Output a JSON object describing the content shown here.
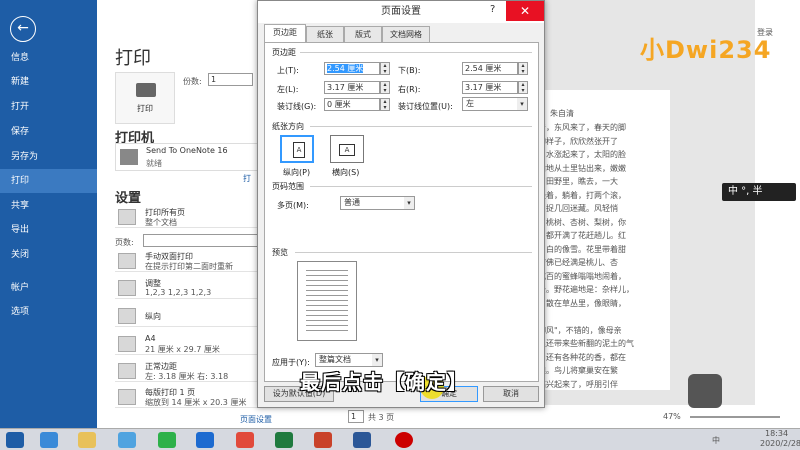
{
  "sidebar": {
    "back_label": "←",
    "items": [
      {
        "label": "信息"
      },
      {
        "label": "新建"
      },
      {
        "label": "打开"
      },
      {
        "label": "保存"
      },
      {
        "label": "另存为"
      },
      {
        "label": "打印"
      },
      {
        "label": "共享"
      },
      {
        "label": "导出"
      },
      {
        "label": "关闭"
      },
      {
        "label": "帐户"
      },
      {
        "label": "选项"
      }
    ]
  },
  "print": {
    "title": "打印",
    "print_button": "打印",
    "copies_label": "份数:",
    "copies_value": "1",
    "printer_heading": "打印机",
    "printer_name": "Send To OneNote 16",
    "printer_status": "就绪",
    "printer_properties": "打",
    "settings_heading": "设置",
    "pages_label": "页数:",
    "settings": [
      {
        "title": "打印所有页",
        "sub": "整个文档"
      },
      {
        "title": "手动双面打印",
        "sub": "在提示打印第二面时重新"
      },
      {
        "title": "调整",
        "sub": "1,2,3    1,2,3    1,2,3"
      },
      {
        "title": "纵向",
        "sub": ""
      },
      {
        "title": "A4",
        "sub": "21 厘米 x 29.7 厘米"
      },
      {
        "title": "正常边距",
        "sub": "左: 3.18 厘米    右: 3.18"
      },
      {
        "title": "每版打印 1 页",
        "sub": "缩放到 14 厘米 x 20.3 厘米"
      }
    ],
    "page_setup_link": "页面设置"
  },
  "preview": {
    "author": "朱自清",
    "lines": [
      "着，东风来了，春天的脚",
      "的样子，欣欣然张开了",
      "，水涨起来了，太阳的脸",
      "偷地从土里钻出来，嫩嫩",
      "，田野里，瞧去，一大",
      "坐着，躺着，打两个滚，",
      "，捉几回迷藏。风轻悄",
      "。桃树、杏树、梨树，你",
      "，都开满了花赶趟儿。红",
      "，白的像雪。花里带着甜",
      "仿佛已经满是桃儿、杏",
      "成百的蜜蜂嗡嗡地闹着，",
      "去。野花遍地是：杂样儿，",
      "，散在草丛里，像眼睛，",
      "",
      "柳风\"，不错的，像母亲",
      "里还带来些新翻的泥土的气",
      "，还有各种花的香，都在",
      "酿。鸟儿将窠巢安在繁",
      "高兴起来了，呼朋引伴"
    ],
    "page_current": "1",
    "page_total": "共 3 页",
    "zoom": "47%",
    "login": "登录"
  },
  "dialog": {
    "title": "页面设置",
    "help": "?",
    "close": "✕",
    "tabs": [
      {
        "label": "页边距"
      },
      {
        "label": "纸张"
      },
      {
        "label": "版式"
      },
      {
        "label": "文档网格"
      }
    ],
    "margins_heading": "页边距",
    "top_label": "上(T):",
    "top_value": "2.54 厘米",
    "bottom_label": "下(B):",
    "bottom_value": "2.54 厘米",
    "left_label": "左(L):",
    "left_value": "3.17 厘米",
    "right_label": "右(R):",
    "right_value": "3.17 厘米",
    "gutter_label": "装订线(G):",
    "gutter_value": "0 厘米",
    "gutter_pos_label": "装订线位置(U):",
    "gutter_pos_value": "左",
    "orientation_heading": "纸张方向",
    "portrait_label": "纵向(P)",
    "landscape_label": "横向(S)",
    "pages_heading": "页码范围",
    "multipage_label": "多页(M):",
    "multipage_value": "普通",
    "preview_heading": "预览",
    "apply_label": "应用于(Y):",
    "apply_value": "整篇文档",
    "default_button": "设为默认值(D)",
    "ok_button": "确定",
    "cancel_button": "取消"
  },
  "overlay": {
    "caption": "最后点击【确定】",
    "logo": "小Dwi234",
    "ime": "中 °, 半"
  },
  "taskbar": {
    "time": "18:34",
    "date": "2020/2/28",
    "ime_indicator": "中"
  }
}
